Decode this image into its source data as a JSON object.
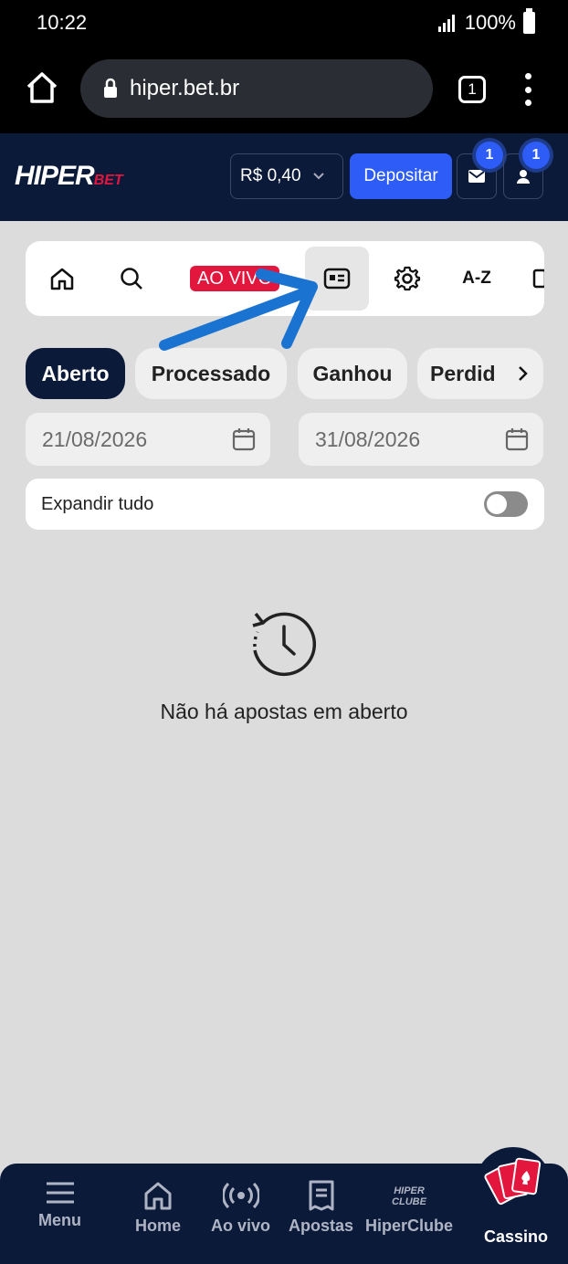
{
  "status": {
    "time": "10:22",
    "battery": "100%"
  },
  "browser": {
    "url": "hiper.bet.br",
    "tab_count": "1"
  },
  "header": {
    "logo_main": "HIPER",
    "logo_sub": "BET",
    "balance": "R$ 0,40",
    "deposit_label": "Depositar",
    "mail_badge": "1",
    "profile_badge": "1"
  },
  "nav": {
    "live_label": "AO VIVO",
    "az_label": "A-Z"
  },
  "filters": [
    "Aberto",
    "Processado",
    "Ganhou",
    "Perdid"
  ],
  "dates": {
    "from": "21/08/2026",
    "to": "31/08/2026"
  },
  "expand_label": "Expandir tudo",
  "empty_message": "Não há apostas em aberto",
  "bottom_nav": {
    "menu": "Menu",
    "home": "Home",
    "live": "Ao vivo",
    "bets": "Apostas",
    "club": "HiperClube",
    "club_logo_top": "HIPER",
    "club_logo_bottom": "CLUBE",
    "casino": "Cassino"
  },
  "colors": {
    "header_bg": "#0c1a3a",
    "accent_blue": "#2d5cf6",
    "live_red": "#e3163e",
    "annotation_arrow": "#1a73d1"
  }
}
